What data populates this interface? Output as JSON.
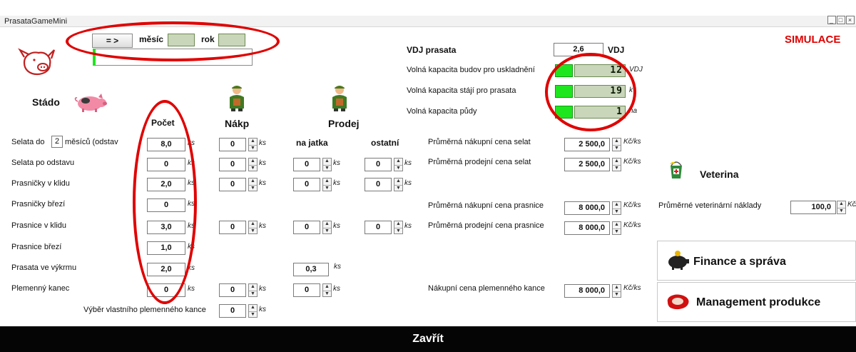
{
  "window": {
    "title": "PrasataGameMini",
    "controls": [
      "_",
      "□",
      "×"
    ]
  },
  "header": {
    "arrow_label": "= >",
    "month_label": "měsíc",
    "year_label": "rok",
    "month_value": "",
    "year_value": "",
    "mode_label": "SIMULACE"
  },
  "capacity": {
    "vdj_label": "VDJ prasata",
    "vdj_value": "2,6",
    "vdj_unit": "VDJ",
    "rows": [
      {
        "label": "Volná kapacita budov pro uskladnění",
        "value": "12",
        "unit": "VDJ"
      },
      {
        "label": "Volná kapacita stájí pro prasata",
        "value": "19",
        "unit": "k"
      },
      {
        "label": "Volná kapacita půdy",
        "value": "1",
        "unit": "ha"
      }
    ]
  },
  "herd": {
    "title": "Stádo",
    "col_count": "Počet",
    "col_buy": "Nákp",
    "col_sell": "Prodej",
    "col_slaughter": "na jatka",
    "col_other": "ostatní",
    "piglet_months": "2",
    "rows": [
      {
        "label_pre": "Selata do",
        "label_post": "měsíců (odstav",
        "count": "8,0",
        "count_unit": "ks",
        "buy": "0",
        "buy_unit": "ks",
        "slaughter": null,
        "other": null
      },
      {
        "label": "Selata po odstavu",
        "count": "0",
        "count_unit": "ks",
        "buy": "0",
        "buy_unit": "ks",
        "slaughter": "0",
        "slaughter_unit": "ks",
        "other": "0",
        "other_unit": "ks"
      },
      {
        "label": "Prasničky v klidu",
        "count": "2,0",
        "count_unit": "ks",
        "buy": "0",
        "buy_unit": "ks",
        "slaughter": "0",
        "slaughter_unit": "ks",
        "other": "0",
        "other_unit": "ks"
      },
      {
        "label": "Prasničky březí",
        "count": "0",
        "count_unit": "ks",
        "buy": null,
        "slaughter": null,
        "other": null
      },
      {
        "label": "Prasnice v klidu",
        "count": "3,0",
        "count_unit": "ks",
        "buy": "0",
        "buy_unit": "ks",
        "slaughter": "0",
        "slaughter_unit": "ks",
        "other": "0",
        "other_unit": "ks"
      },
      {
        "label": "Prasnice březí",
        "count": "1,0",
        "count_unit": "ks",
        "buy": null,
        "slaughter": null,
        "other": null
      },
      {
        "label": "Prasata ve výkrmu",
        "count": "2,0",
        "count_unit": "ks",
        "buy": null,
        "slaughter_static": "0,3",
        "slaughter_unit": "ks",
        "other": null
      },
      {
        "label": "Plemenný kanec",
        "count": "0",
        "count_unit": "ks",
        "buy": "0",
        "buy_unit": "ks",
        "slaughter": "0",
        "slaughter_unit": "ks",
        "other": null
      }
    ],
    "own_boar_label": "Výběr vlastního plemenného kance",
    "own_boar_value": "0",
    "own_boar_unit": "ks"
  },
  "prices": {
    "rows": [
      {
        "label": "Průměrná nákupní cena selat",
        "value": "2 500,0",
        "unit": "Kč/ks"
      },
      {
        "label": "Průměrná prodejní cena selat",
        "value": "2 500,0",
        "unit": "Kč/ks"
      },
      {
        "label": "Průměrná nákupní cena prasnice",
        "value": "8 000,0",
        "unit": "Kč/ks"
      },
      {
        "label": "Průměrná prodejní cena prasnice",
        "value": "8 000,0",
        "unit": "Kč/ks"
      },
      {
        "label": "Nákupní cena plemenného kance",
        "value": "8 000,0",
        "unit": "Kč/ks"
      }
    ]
  },
  "vet": {
    "title": "Veterina",
    "cost_label": "Průměrné veterinární náklady",
    "cost_value": "100,0",
    "cost_unit": "Kč/ks/mě"
  },
  "nav": {
    "finance_label": "Finance a správa",
    "management_label": "Management produkce"
  },
  "footer": {
    "close_label": "Zavřít"
  },
  "colors": {
    "highlight_ring": "#e00000",
    "mode_text": "#e00000",
    "indicator_green": "#1ee61e",
    "lcd_bg": "#c9d6ba",
    "footer_bg": "#050505"
  }
}
